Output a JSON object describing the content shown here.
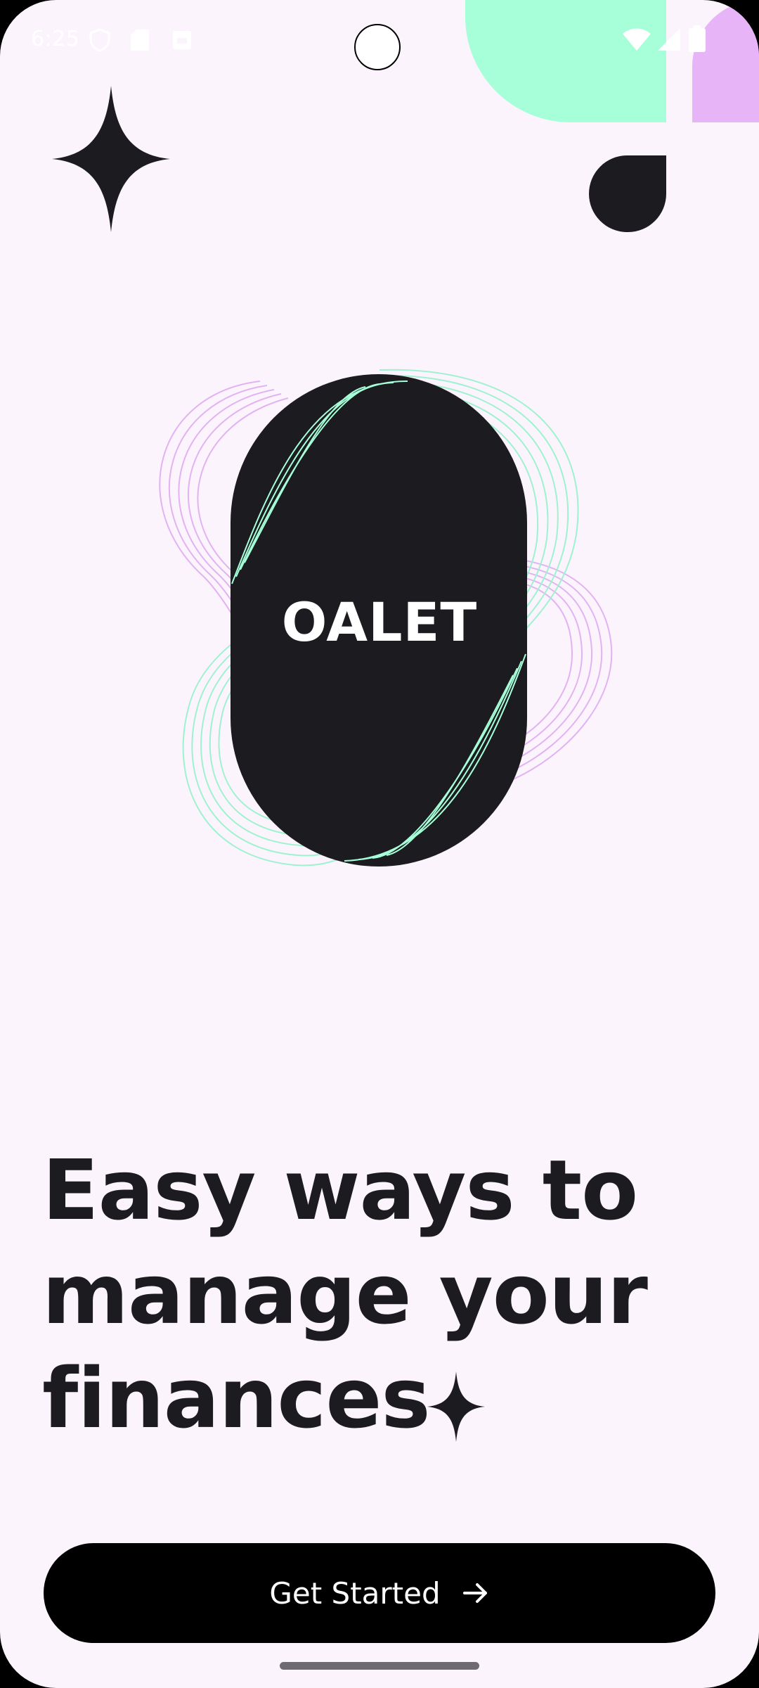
{
  "status_bar": {
    "time": "6:25",
    "icons": [
      "shield-icon",
      "sim-card-icon",
      "notification-icon",
      "wifi-icon",
      "cell-signal-icon",
      "battery-icon"
    ]
  },
  "hero": {
    "brand": "OALET"
  },
  "headline": {
    "line1": "Easy ways to",
    "line2": "manage your",
    "line3": "finances"
  },
  "cta": {
    "label": "Get Started",
    "icon": "arrow-right-icon"
  },
  "colors": {
    "background": "#fcf4fc",
    "dark": "#1c1b1f",
    "mint": "#a6ffd8",
    "lilac": "#e8b4f8",
    "button": "#000000",
    "button_text": "#ffffff"
  }
}
